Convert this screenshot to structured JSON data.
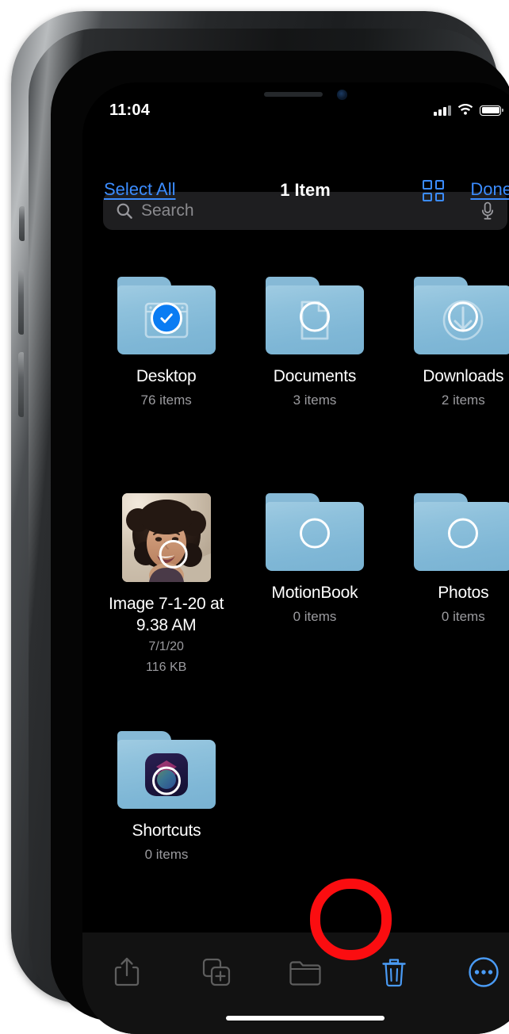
{
  "device": {
    "frame": "iphone-x",
    "notch": {
      "speaker": "earpiece-speaker",
      "camera": "front-camera"
    }
  },
  "status_bar": {
    "time": "11:04",
    "cellular_icon": "signal-bars-icon",
    "cellular_bars_filled": 3,
    "cellular_bars_total": 4,
    "wifi_icon": "wifi-icon",
    "battery_icon": "battery-full-icon",
    "battery_level_percent": 100
  },
  "nav_bar": {
    "select_all_label": "Select All",
    "title": "1 Item",
    "grid_view_icon": "grid-view-icon",
    "done_label": "Done"
  },
  "search": {
    "placeholder": "Search",
    "value": "",
    "search_icon": "search-icon",
    "mic_icon": "microphone-icon"
  },
  "colors": {
    "accent_blue": "#3b8cff",
    "toolbar_blue": "#4a9bf5",
    "check_blue": "#0a7cf3",
    "annotation_red": "#fb0d10",
    "folder_blue": "#8ec1dc",
    "background": "#000000",
    "toolbar_bg": "#121212",
    "search_bg": "#1e1e20",
    "secondary_text": "#9b9b9f"
  },
  "files": [
    {
      "name": "Desktop",
      "meta": "76 items",
      "kind": "folder",
      "glyph": "desktop-window-icon",
      "selected": true
    },
    {
      "name": "Documents",
      "meta": "3 items",
      "kind": "folder",
      "glyph": "document-page-icon",
      "selected": false
    },
    {
      "name": "Downloads",
      "meta": "2 items",
      "kind": "folder",
      "glyph": "download-arrow-icon",
      "selected": false
    },
    {
      "name": "Image 7-1-20 at 9.38 AM",
      "meta": "7/1/20",
      "meta2": "116 KB",
      "kind": "image",
      "glyph": "photo-thumbnail",
      "selected": false
    },
    {
      "name": "MotionBook",
      "meta": "0 items",
      "kind": "folder",
      "glyph": "plain-folder",
      "selected": false
    },
    {
      "name": "Photos",
      "meta": "0 items",
      "kind": "folder",
      "glyph": "plain-folder",
      "selected": false
    },
    {
      "name": "Shortcuts",
      "meta": "0 items",
      "kind": "folder",
      "glyph": "shortcuts-app-icon",
      "selected": false
    }
  ],
  "toolbar": {
    "items": [
      {
        "icon": "share-icon",
        "label": "Share",
        "enabled": false,
        "highlighted": false
      },
      {
        "icon": "duplicate-icon",
        "label": "Duplicate",
        "enabled": false,
        "highlighted": false
      },
      {
        "icon": "new-folder-icon",
        "label": "Move",
        "enabled": false,
        "highlighted": false
      },
      {
        "icon": "trash-icon",
        "label": "Delete",
        "enabled": true,
        "highlighted": true
      },
      {
        "icon": "more-ellipsis-icon",
        "label": "More",
        "enabled": true,
        "highlighted": false
      }
    ]
  },
  "annotation": {
    "shape": "circle-outline",
    "target": "trash-icon",
    "color": "#fb0d10"
  }
}
